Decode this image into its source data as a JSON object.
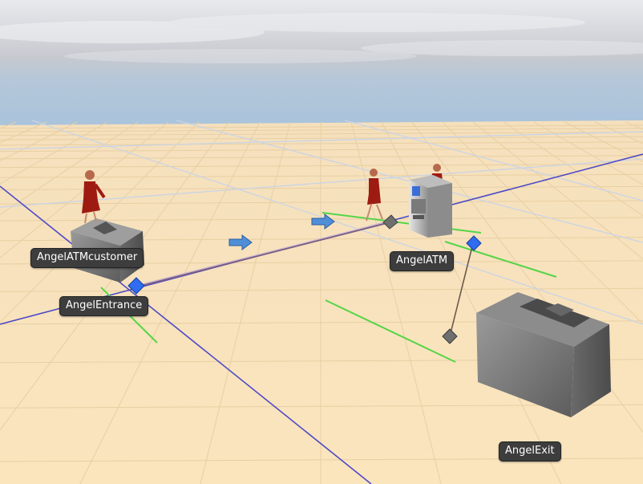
{
  "scene": {
    "colors": {
      "sky_top": "#c7cbd2",
      "sky_bottom": "#a9c4dc",
      "floor": "#f7dfb6",
      "grid_minor": "#e7cfa4",
      "grid_major": "#c3d3e6",
      "axis_line": "#5a57c8",
      "path_line": "#8a6a8c",
      "green_line": "#54d44a",
      "arrow": "#4f8fd8",
      "node": "#2f6cf0",
      "object_gray": "#808080",
      "figure_red": "#a11d14",
      "label_bg": "#3d3d3d",
      "label_text": "#ffffff"
    },
    "objects": [
      {
        "id": "customer_source",
        "label": "AngelATMcustomer"
      },
      {
        "id": "entrance",
        "label": "AngelEntrance"
      },
      {
        "id": "atm",
        "label": "AngelATM"
      },
      {
        "id": "exit",
        "label": "AngelExit"
      }
    ],
    "icons": [
      "flow-arrow-icon",
      "control-point-icon",
      "person-figure-icon",
      "atm-machine-icon",
      "source-box-icon",
      "sink-box-icon"
    ]
  }
}
